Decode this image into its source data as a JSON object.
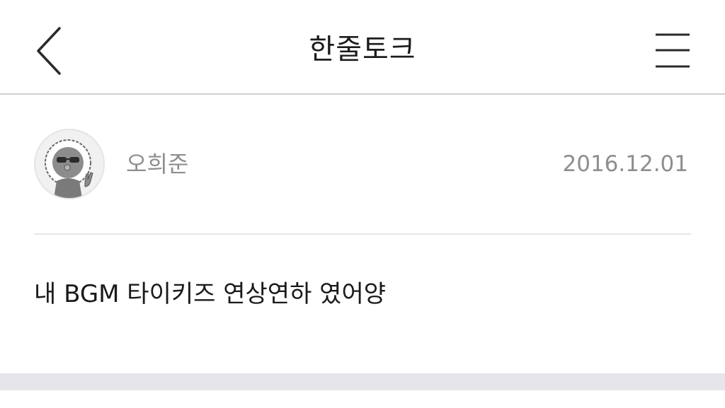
{
  "header": {
    "title": "한줄토크",
    "back_icon": "chevron-left-icon",
    "menu_icon": "hamburger-menu-icon"
  },
  "post": {
    "author": {
      "name": "오희준",
      "avatar_icon": "character-avatar-icon"
    },
    "date": "2016.12.01",
    "body": "내 BGM 타이키즈 연상연하 였어양"
  },
  "colors": {
    "background": "#ffffff",
    "divider": "#e6e6e6",
    "secondary_text": "#8e8e8e",
    "primary_text": "#1a1a1a",
    "footer_band": "#e6e6ea"
  }
}
